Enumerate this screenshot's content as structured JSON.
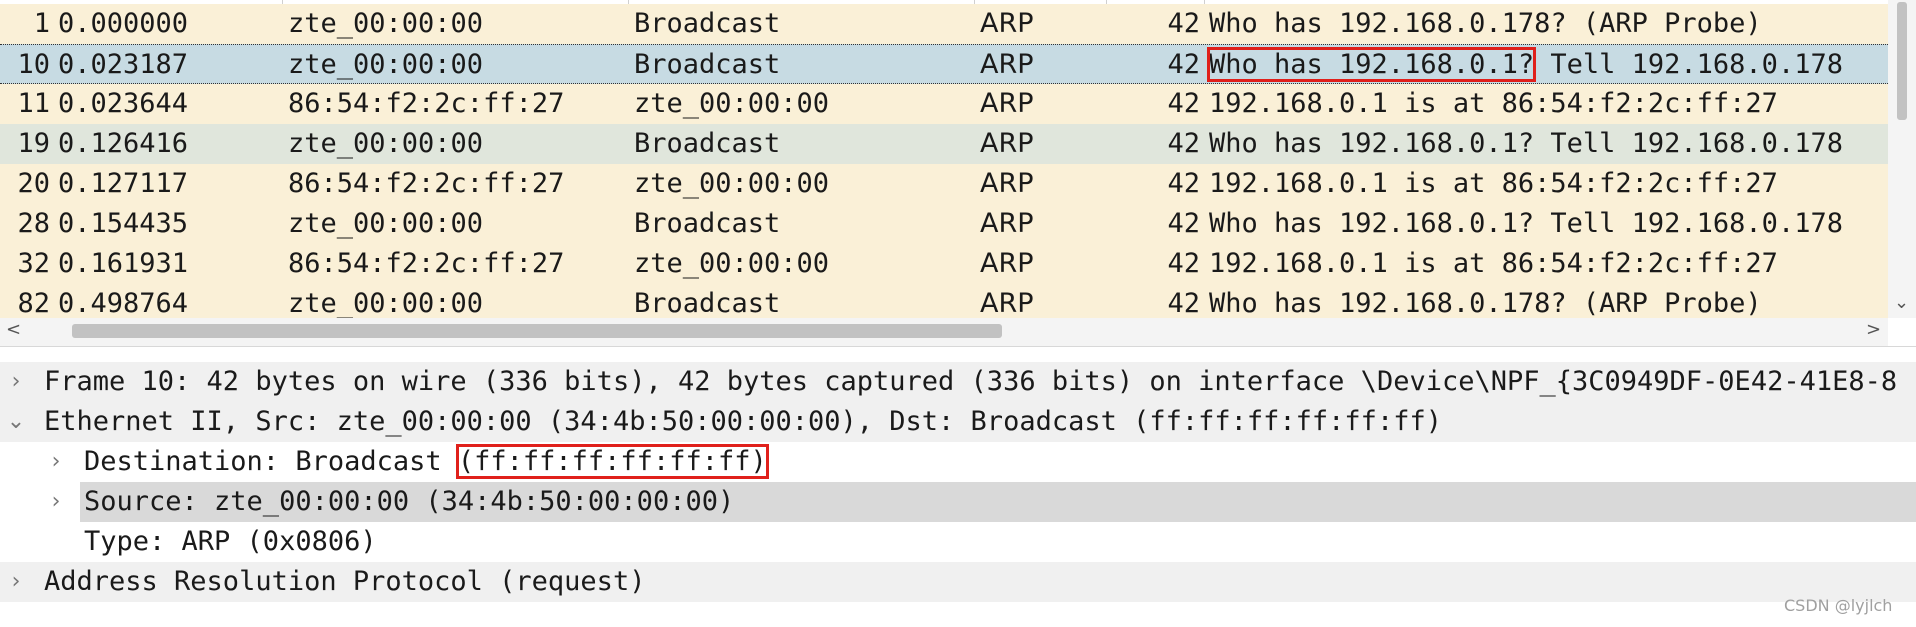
{
  "packets": [
    {
      "no": "1",
      "time": "0.000000",
      "source": "zte_00:00:00",
      "destination": "Broadcast",
      "protocol": "ARP",
      "length": "42",
      "info": "Who has 192.168.0.178? (ARP Probe)"
    },
    {
      "no": "10",
      "time": "0.023187",
      "source": "zte_00:00:00",
      "destination": "Broadcast",
      "protocol": "ARP",
      "length": "42",
      "info_a": "Who has 192.168.0.1?",
      "info_b": " Tell 192.168.0.178",
      "selected": true
    },
    {
      "no": "11",
      "time": "0.023644",
      "source": "86:54:f2:2c:ff:27",
      "destination": "zte_00:00:00",
      "protocol": "ARP",
      "length": "42",
      "info": "192.168.0.1 is at 86:54:f2:2c:ff:27"
    },
    {
      "no": "19",
      "time": "0.126416",
      "source": "zte_00:00:00",
      "destination": "Broadcast",
      "protocol": "ARP",
      "length": "42",
      "info": "Who has 192.168.0.1? Tell 192.168.0.178"
    },
    {
      "no": "20",
      "time": "0.127117",
      "source": "86:54:f2:2c:ff:27",
      "destination": "zte_00:00:00",
      "protocol": "ARP",
      "length": "42",
      "info": "192.168.0.1 is at 86:54:f2:2c:ff:27"
    },
    {
      "no": "28",
      "time": "0.154435",
      "source": "zte_00:00:00",
      "destination": "Broadcast",
      "protocol": "ARP",
      "length": "42",
      "info": "Who has 192.168.0.1? Tell 192.168.0.178"
    },
    {
      "no": "32",
      "time": "0.161931",
      "source": "86:54:f2:2c:ff:27",
      "destination": "zte_00:00:00",
      "protocol": "ARP",
      "length": "42",
      "info": "192.168.0.1 is at 86:54:f2:2c:ff:27"
    },
    {
      "no": "82",
      "time": "0.498764",
      "source": "zte_00:00:00",
      "destination": "Broadcast",
      "protocol": "ARP",
      "length": "42",
      "info": "Who has 192.168.0.178? (ARP Probe)"
    }
  ],
  "details": {
    "frame": "Frame 10: 42 bytes on wire (336 bits), 42 bytes captured (336 bits) on interface \\Device\\NPF_{3C0949DF-0E42-41E8-8",
    "ethernet": "Ethernet II, Src: zte_00:00:00 (34:4b:50:00:00:00), Dst: Broadcast (ff:ff:ff:ff:ff:ff)",
    "destination_a": "Destination: Broadcast ",
    "destination_b": "(ff:ff:ff:ff:ff:ff)",
    "source": "Source: zte_00:00:00 (34:4b:50:00:00:00)",
    "type": "Type: ARP (0x0806)",
    "arp": "Address Resolution Protocol (request)"
  },
  "icons": {
    "collapsed": "›",
    "expanded": "⌄",
    "scroll_left": "<",
    "scroll_right": ">",
    "scroll_down": "⌄"
  },
  "watermark": "CSDN @lyjlch",
  "colors": {
    "row_bg": "#faf0d7",
    "selected_bg": "#c7dbe3",
    "alt_bg": "#e0e6dc",
    "highlight_box": "#e0201b"
  }
}
